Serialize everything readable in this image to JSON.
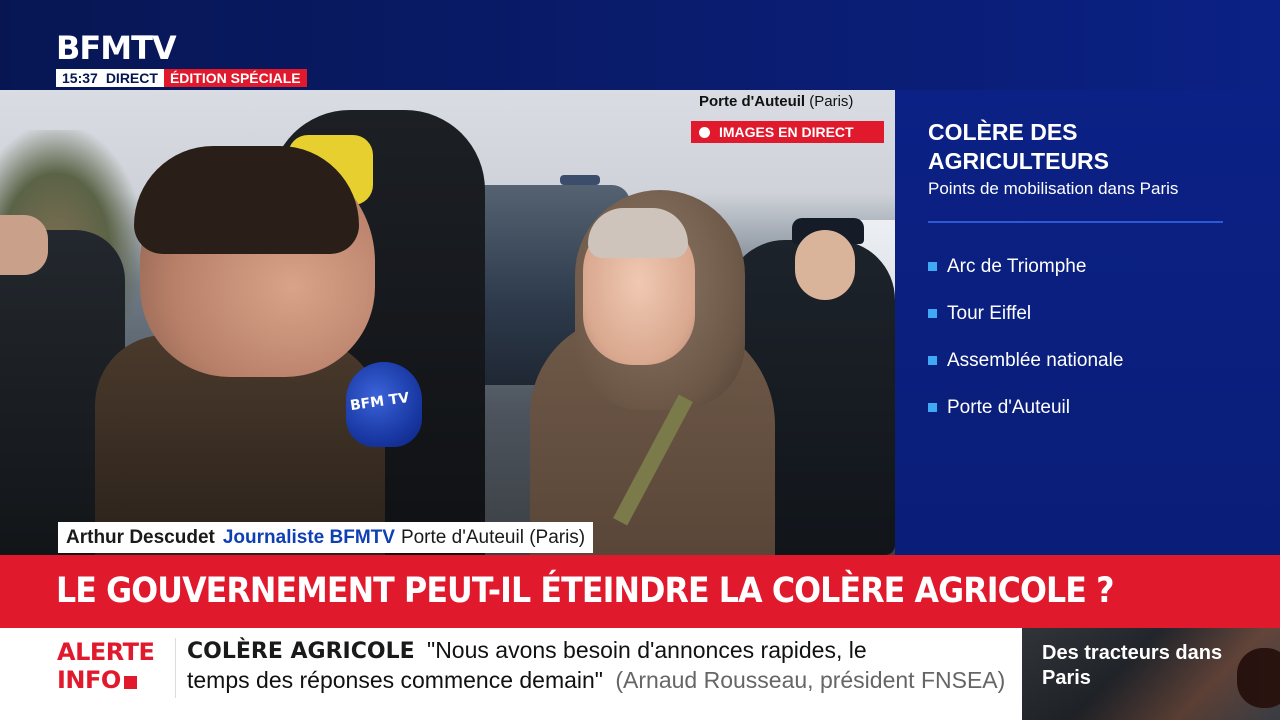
{
  "channel": {
    "logo": "BFMTV",
    "time": "15:37",
    "direct_label": "DIRECT",
    "edition_label": "ÉDITION SPÉCIALE"
  },
  "video": {
    "location_name": "Porte d'Auteuil",
    "location_city": "(Paris)",
    "live_label": "IMAGES EN DIRECT",
    "mic_label": "BFM TV"
  },
  "lower_third": {
    "name": "Arthur Descudet",
    "role": "Journaliste BFMTV",
    "location": "Porte d'Auteuil (Paris)"
  },
  "panel": {
    "title": "COLÈRE DES AGRICULTEURS",
    "subtitle": "Points de mobilisation dans Paris",
    "items": [
      {
        "label": "Arc de Triomphe"
      },
      {
        "label": "Tour Eiffel"
      },
      {
        "label": "Assemblée nationale"
      },
      {
        "label": "Porte d'Auteuil"
      }
    ]
  },
  "headline": {
    "text": "LE GOUVERNEMENT PEUT-IL ÉTEINDRE LA COLÈRE AGRICOLE ?"
  },
  "ticker": {
    "alert_line1": "ALERTE",
    "alert_line2": "INFO",
    "topic": "COLÈRE AGRICOLE",
    "quote_line1": "\"Nous avons besoin d'annonces rapides, le",
    "quote_line2": "temps des réponses commence demain\"",
    "attribution": "(Arnaud Rousseau, président FNSEA)"
  },
  "teaser": {
    "text": "Des tracteurs dans Paris"
  },
  "colors": {
    "brand_blue": "#0b2185",
    "alert_red": "#e1192d",
    "accent_blue": "#3fa9f5"
  }
}
